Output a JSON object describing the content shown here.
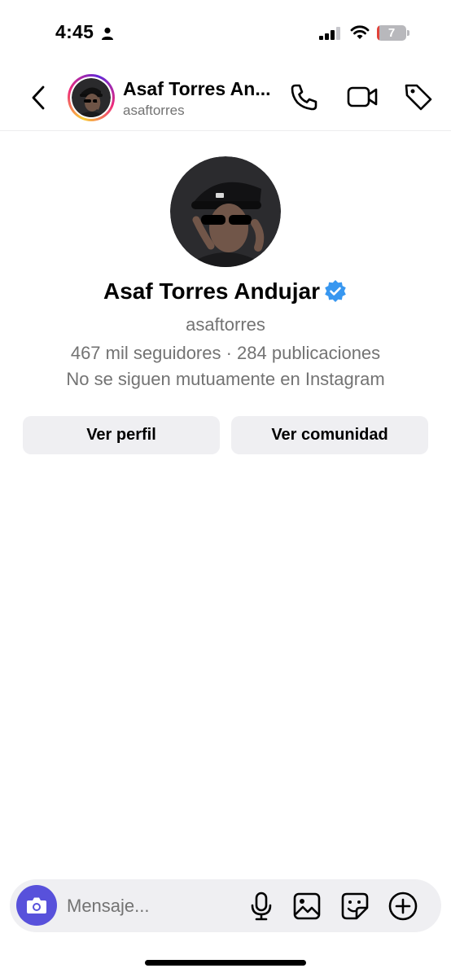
{
  "status_bar": {
    "time": "4:45",
    "battery_level": "7",
    "battery_fraction": 0.07,
    "icons": [
      "person-icon",
      "signal-icon",
      "wifi-icon",
      "battery-icon"
    ]
  },
  "header": {
    "name": "Asaf Torres An...",
    "username": "asaftorres",
    "icons": [
      "back-chevron-icon",
      "phone-icon",
      "video-camera-icon",
      "tag-icon"
    ]
  },
  "profile": {
    "name": "Asaf Torres Andujar",
    "username": "asaftorres",
    "stats": "467 mil seguidores · 284 publicaciones",
    "mutual": "No se siguen mutuamente en Instagram",
    "verified": true
  },
  "actions": {
    "view_profile": "Ver perfil",
    "view_community": "Ver comunidad"
  },
  "composer": {
    "placeholder": "Mensaje...",
    "icons": [
      "camera-icon",
      "microphone-icon",
      "gallery-icon",
      "sticker-icon",
      "plus-circle-icon"
    ]
  },
  "colors": {
    "accent": "#5851db",
    "verified": "#3897f0",
    "secondary_text": "#737373",
    "button_bg": "#efeff2"
  }
}
